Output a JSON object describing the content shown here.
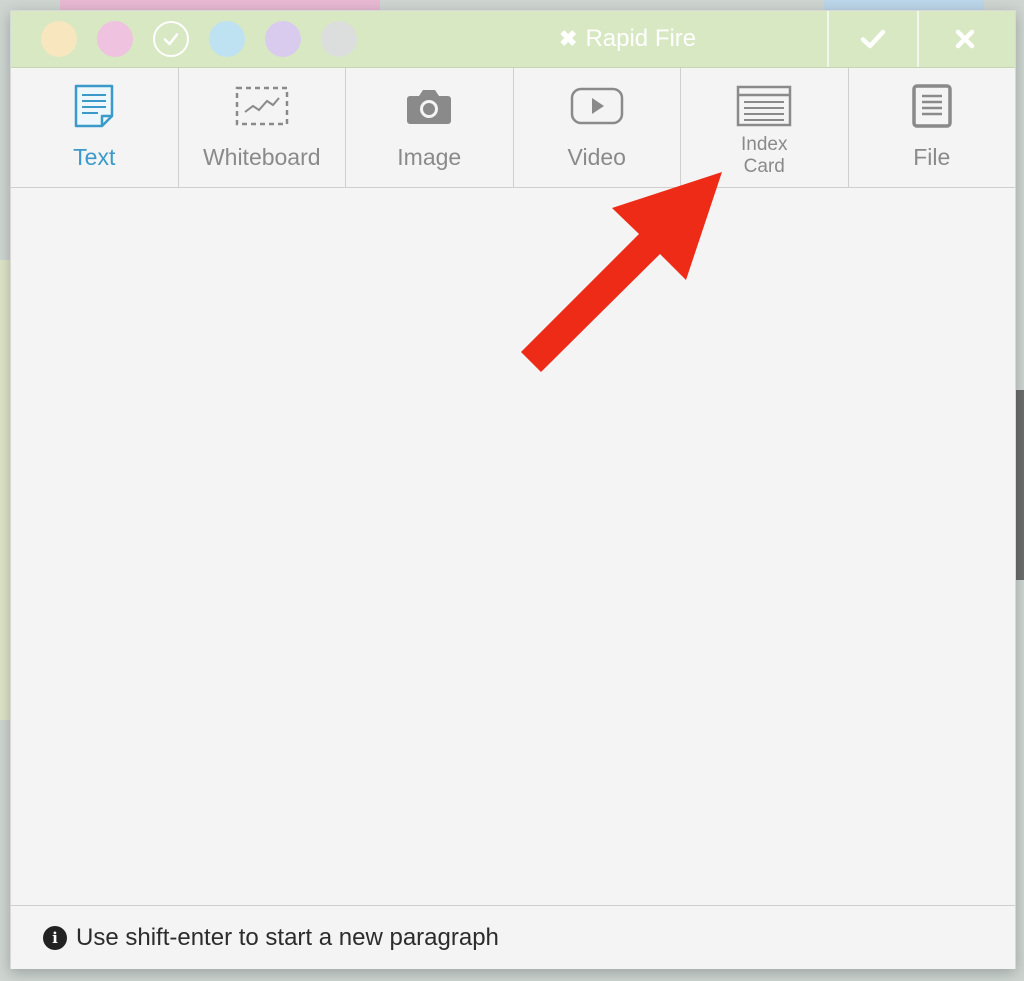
{
  "dialog": {
    "title": "Rapid Fire",
    "close_glyph": "✖",
    "colors": [
      {
        "name": "yellow",
        "hex": "#f8e7be"
      },
      {
        "name": "pink",
        "hex": "#efc2df"
      },
      {
        "name": "green",
        "hex": "#d7e8c3",
        "selected": true
      },
      {
        "name": "blue",
        "hex": "#bfe2f2"
      },
      {
        "name": "purple",
        "hex": "#d9cbee"
      },
      {
        "name": "gray",
        "hex": "#dcdede"
      }
    ],
    "confirm_icon": "check-icon",
    "cancel_icon": "close-icon"
  },
  "tabs": [
    {
      "label": "Text",
      "icon": "note-icon",
      "active": true
    },
    {
      "label": "Whiteboard",
      "icon": "whiteboard-icon"
    },
    {
      "label": "Image",
      "icon": "camera-icon"
    },
    {
      "label": "Video",
      "icon": "play-icon"
    },
    {
      "label": "Index\nCard",
      "icon": "index-card-icon"
    },
    {
      "label": "File",
      "icon": "file-icon"
    }
  ],
  "footer": {
    "info_icon": "info-icon",
    "hint": "Use shift-enter to start a new paragraph"
  },
  "annotation": {
    "arrow_color": "#ee2b16",
    "points_to": "Index Card tab"
  },
  "accent_color": "#3b9ac9"
}
